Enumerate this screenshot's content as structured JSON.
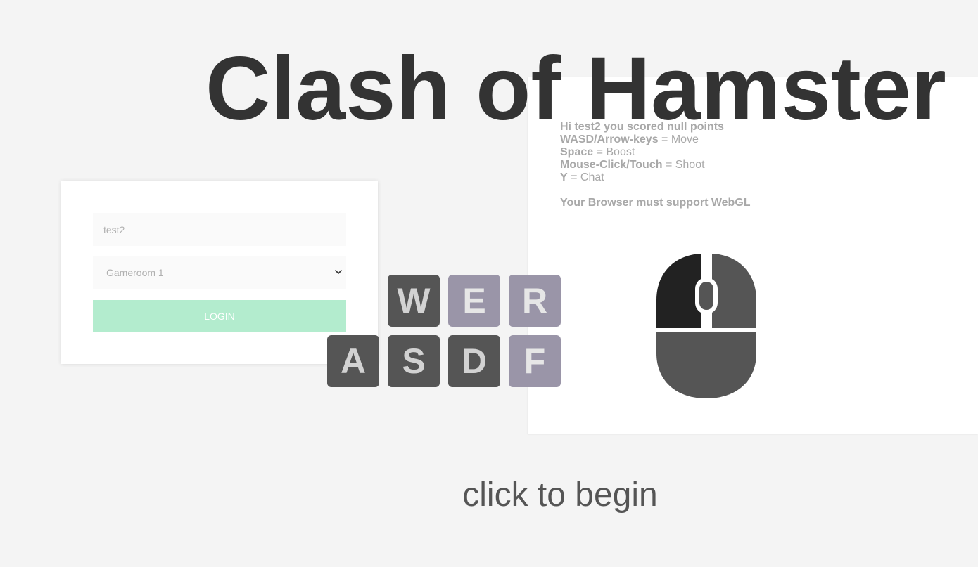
{
  "game": {
    "title": "Clash of Hamster",
    "cta": "click to begin"
  },
  "instructions": {
    "greeting": "Hi test2 you scored null points",
    "controls": [
      {
        "key": "WASD/Arrow-keys",
        "sep": " = ",
        "action": "Move"
      },
      {
        "key": "Space",
        "sep": " = ",
        "action": "Boost"
      },
      {
        "key": "Mouse-Click/Touch",
        "sep": " = ",
        "action": "Shoot"
      },
      {
        "key": "Y",
        "sep": " = ",
        "action": "Chat"
      }
    ],
    "requirement": "Your Browser must support WebGL"
  },
  "login": {
    "username_value": "test2",
    "room_selected": "Gameroom 1",
    "room_options": [
      "Gameroom 1"
    ],
    "button_label": "LOGIN"
  },
  "keyboard": {
    "keys": [
      {
        "label": "W",
        "style": "dark"
      },
      {
        "label": "E",
        "style": "light"
      },
      {
        "label": "R",
        "style": "light"
      },
      {
        "label": "A",
        "style": "dark"
      },
      {
        "label": "S",
        "style": "dark"
      },
      {
        "label": "D",
        "style": "dark"
      },
      {
        "label": "F",
        "style": "light"
      }
    ]
  },
  "mouse_icon": "mouse-icon",
  "colors": {
    "title": "#333333",
    "key_dark": "#555555",
    "key_light": "#9a95a8",
    "login_button": "#b3ecce",
    "instruction_text": "#a8a8a8",
    "mouse_left_button": "#222222",
    "mouse_body": "#555555"
  }
}
